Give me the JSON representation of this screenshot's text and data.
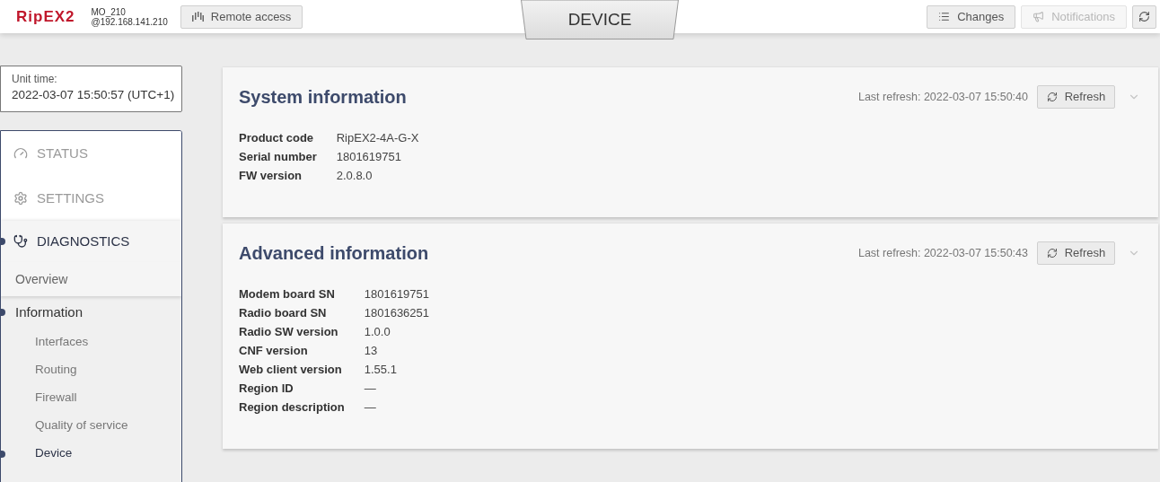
{
  "header": {
    "logo": "RipEX2",
    "device_name": "MO_210",
    "device_address": "@192.168.141.210",
    "remote_access": "Remote access",
    "page_title": "DEVICE",
    "buttons": [
      {
        "kind": "changes",
        "label": "Changes",
        "disabled": false
      },
      {
        "kind": "notifications",
        "label": "Notifications",
        "disabled": true
      },
      {
        "kind": "reload",
        "disabled": false
      }
    ]
  },
  "unit_time": {
    "label": "Unit time:",
    "value": "2022-03-07 15:50:57 (UTC+1)"
  },
  "nav": {
    "sections": [
      {
        "kind": "status",
        "label": "STATUS",
        "selected": false
      },
      {
        "kind": "settings",
        "label": "SETTINGS",
        "selected": false
      },
      {
        "kind": "diagnostics",
        "label": "DIAGNOSTICS",
        "selected": true
      }
    ],
    "items": [
      {
        "label": "Overview",
        "selected": false
      },
      {
        "label": "Information",
        "selected": true,
        "children": [
          {
            "label": "Interfaces",
            "selected": false
          },
          {
            "label": "Routing",
            "selected": false
          },
          {
            "label": "Firewall",
            "selected": false
          },
          {
            "label": "Quality of service",
            "selected": false
          },
          {
            "label": "Device",
            "selected": true
          }
        ]
      }
    ]
  },
  "cards": [
    {
      "title": "System information",
      "last_refresh": "Last refresh: 2022-03-07 15:50:40",
      "refresh": "Refresh",
      "expanded": true,
      "rows": [
        {
          "label": "Product code",
          "value": "RipEX2-4A-G-X"
        },
        {
          "label": "Serial number",
          "value": "1801619751"
        },
        {
          "label": "FW version",
          "value": "2.0.8.0"
        }
      ]
    },
    {
      "title": "Advanced information",
      "last_refresh": "Last refresh: 2022-03-07 15:50:43",
      "refresh": "Refresh",
      "expanded": true,
      "rows": [
        {
          "label": "Modem board SN",
          "value": "1801619751"
        },
        {
          "label": "Radio board SN",
          "value": "1801636251"
        },
        {
          "label": "Radio SW version",
          "value": "1.0.0"
        },
        {
          "label": "CNF version",
          "value": "13"
        },
        {
          "label": "Web client version",
          "value": "1.55.1"
        },
        {
          "label": "Region ID",
          "value": "—"
        },
        {
          "label": "Region description",
          "value": "—"
        }
      ]
    }
  ]
}
